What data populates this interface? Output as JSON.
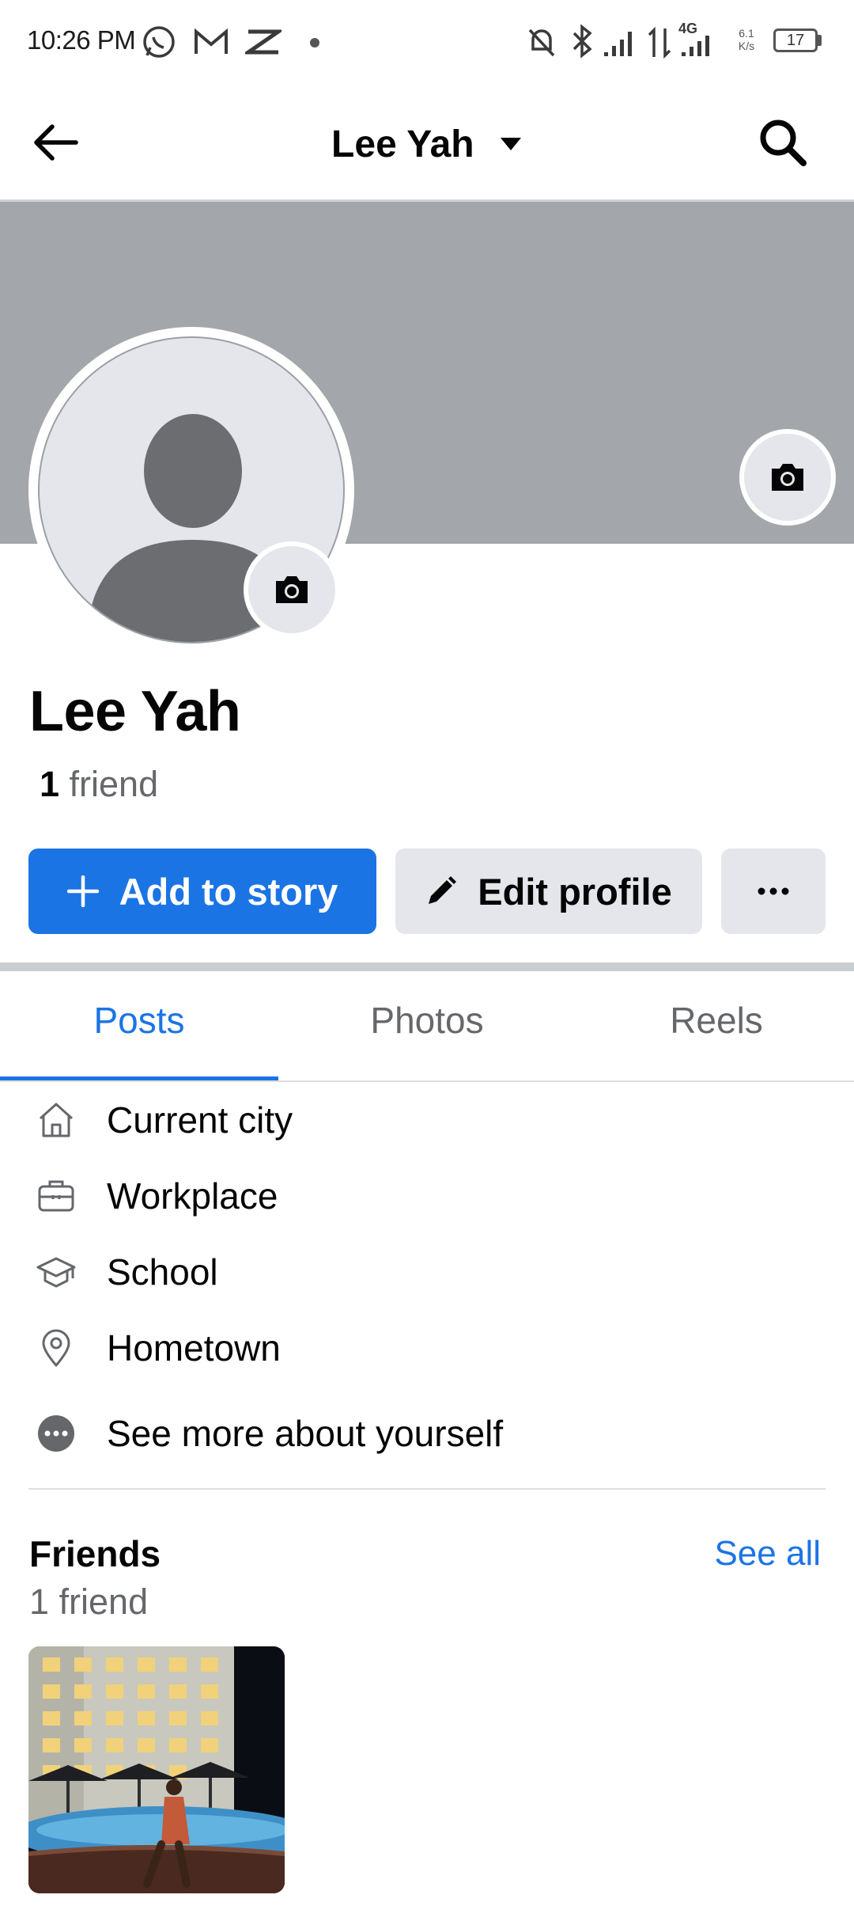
{
  "status_bar": {
    "time": "10:26 PM",
    "network_type": "4G",
    "speed_value": "6.1",
    "speed_unit": "K/s",
    "battery": "17"
  },
  "header": {
    "title": "Lee Yah"
  },
  "profile": {
    "name": "Lee Yah",
    "friend_count": "1",
    "friend_word": "friend"
  },
  "actions": {
    "add_story": "Add to story",
    "edit_profile": "Edit profile"
  },
  "tabs": [
    {
      "label": "Posts",
      "active": true
    },
    {
      "label": "Photos",
      "active": false
    },
    {
      "label": "Reels",
      "active": false
    }
  ],
  "about": [
    {
      "icon": "home-icon",
      "label": "Current city"
    },
    {
      "icon": "briefcase-icon",
      "label": "Workplace"
    },
    {
      "icon": "graduation-cap-icon",
      "label": "School"
    },
    {
      "icon": "location-pin-icon",
      "label": "Hometown"
    },
    {
      "icon": "more-dots-icon",
      "label": "See more about yourself"
    }
  ],
  "friends": {
    "title": "Friends",
    "see_all": "See all",
    "subtitle": "1 friend"
  },
  "colors": {
    "accent": "#1b74e4",
    "cover": "#a3a6aa",
    "button_gray": "#e4e6eb"
  }
}
